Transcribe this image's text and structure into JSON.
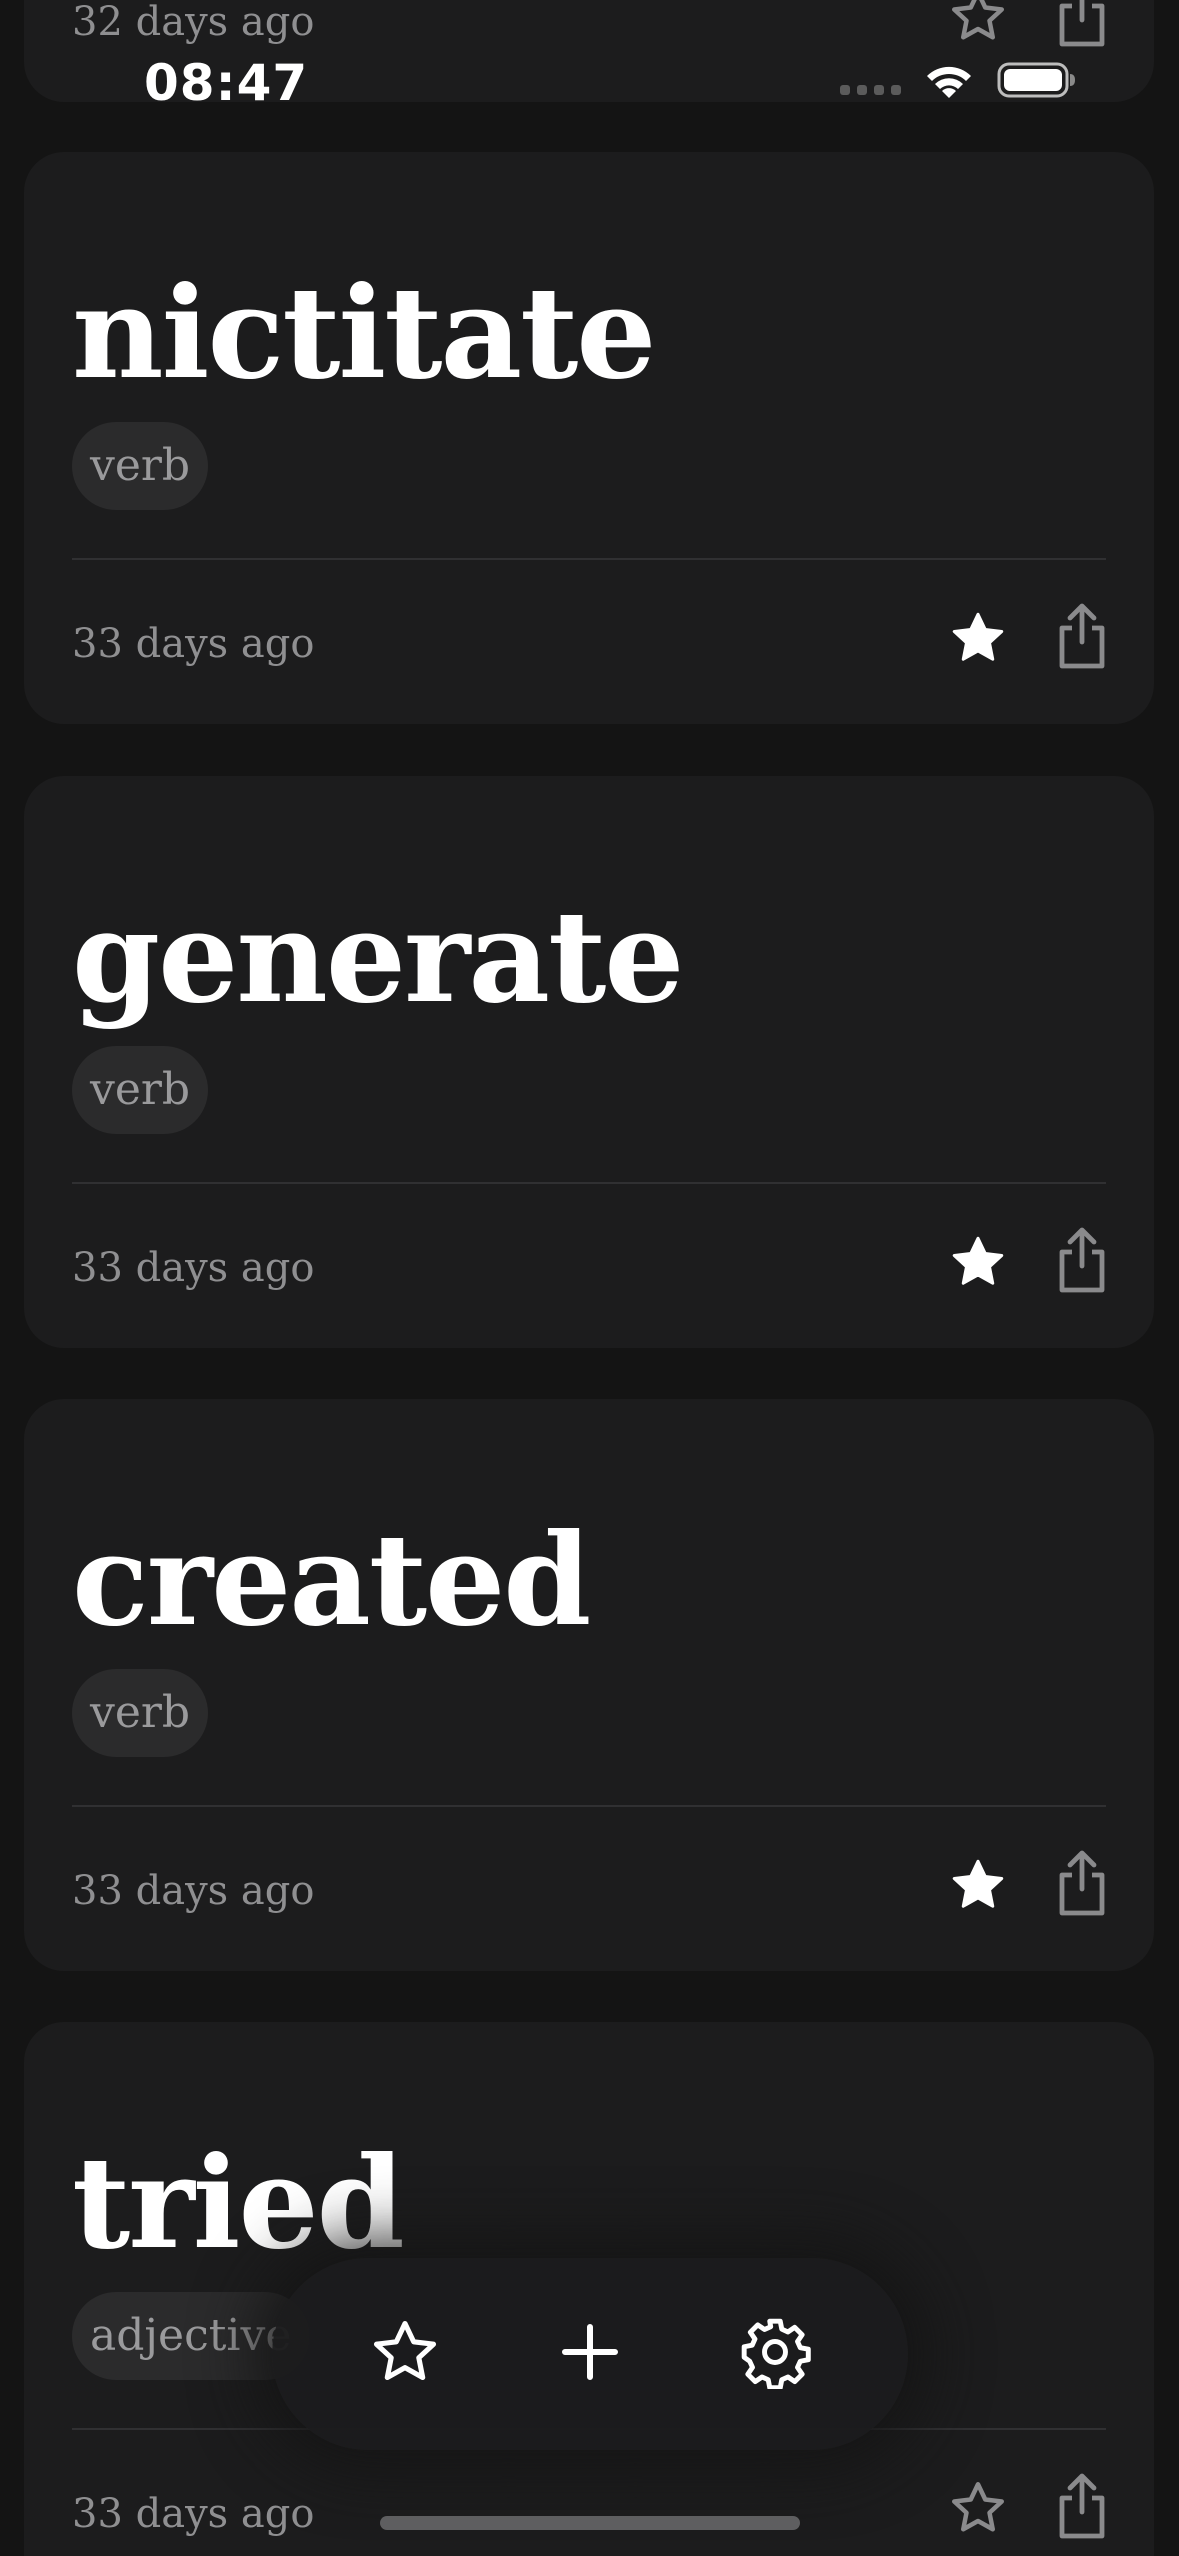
{
  "status_bar": {
    "time": "08:47"
  },
  "cards": [
    {
      "word": "",
      "part_of_speech": "",
      "timestamp": "32 days ago",
      "starred": false
    },
    {
      "word": "nictitate",
      "part_of_speech": "verb",
      "timestamp": "33 days ago",
      "starred": true
    },
    {
      "word": "generate",
      "part_of_speech": "verb",
      "timestamp": "33 days ago",
      "starred": true
    },
    {
      "word": "created",
      "part_of_speech": "verb",
      "timestamp": "33 days ago",
      "starred": true
    },
    {
      "word": "tried",
      "part_of_speech": "adjective",
      "timestamp": "33 days ago",
      "starred": false
    }
  ],
  "toolbar": {
    "buttons": [
      "star-icon",
      "plus-icon",
      "gear-icon"
    ]
  },
  "colors": {
    "background": "#141414",
    "card": "#1c1c1d",
    "pill": "#2b2b2c",
    "muted_text": "#8f8f91",
    "icon_muted": "#8a8a8c"
  }
}
